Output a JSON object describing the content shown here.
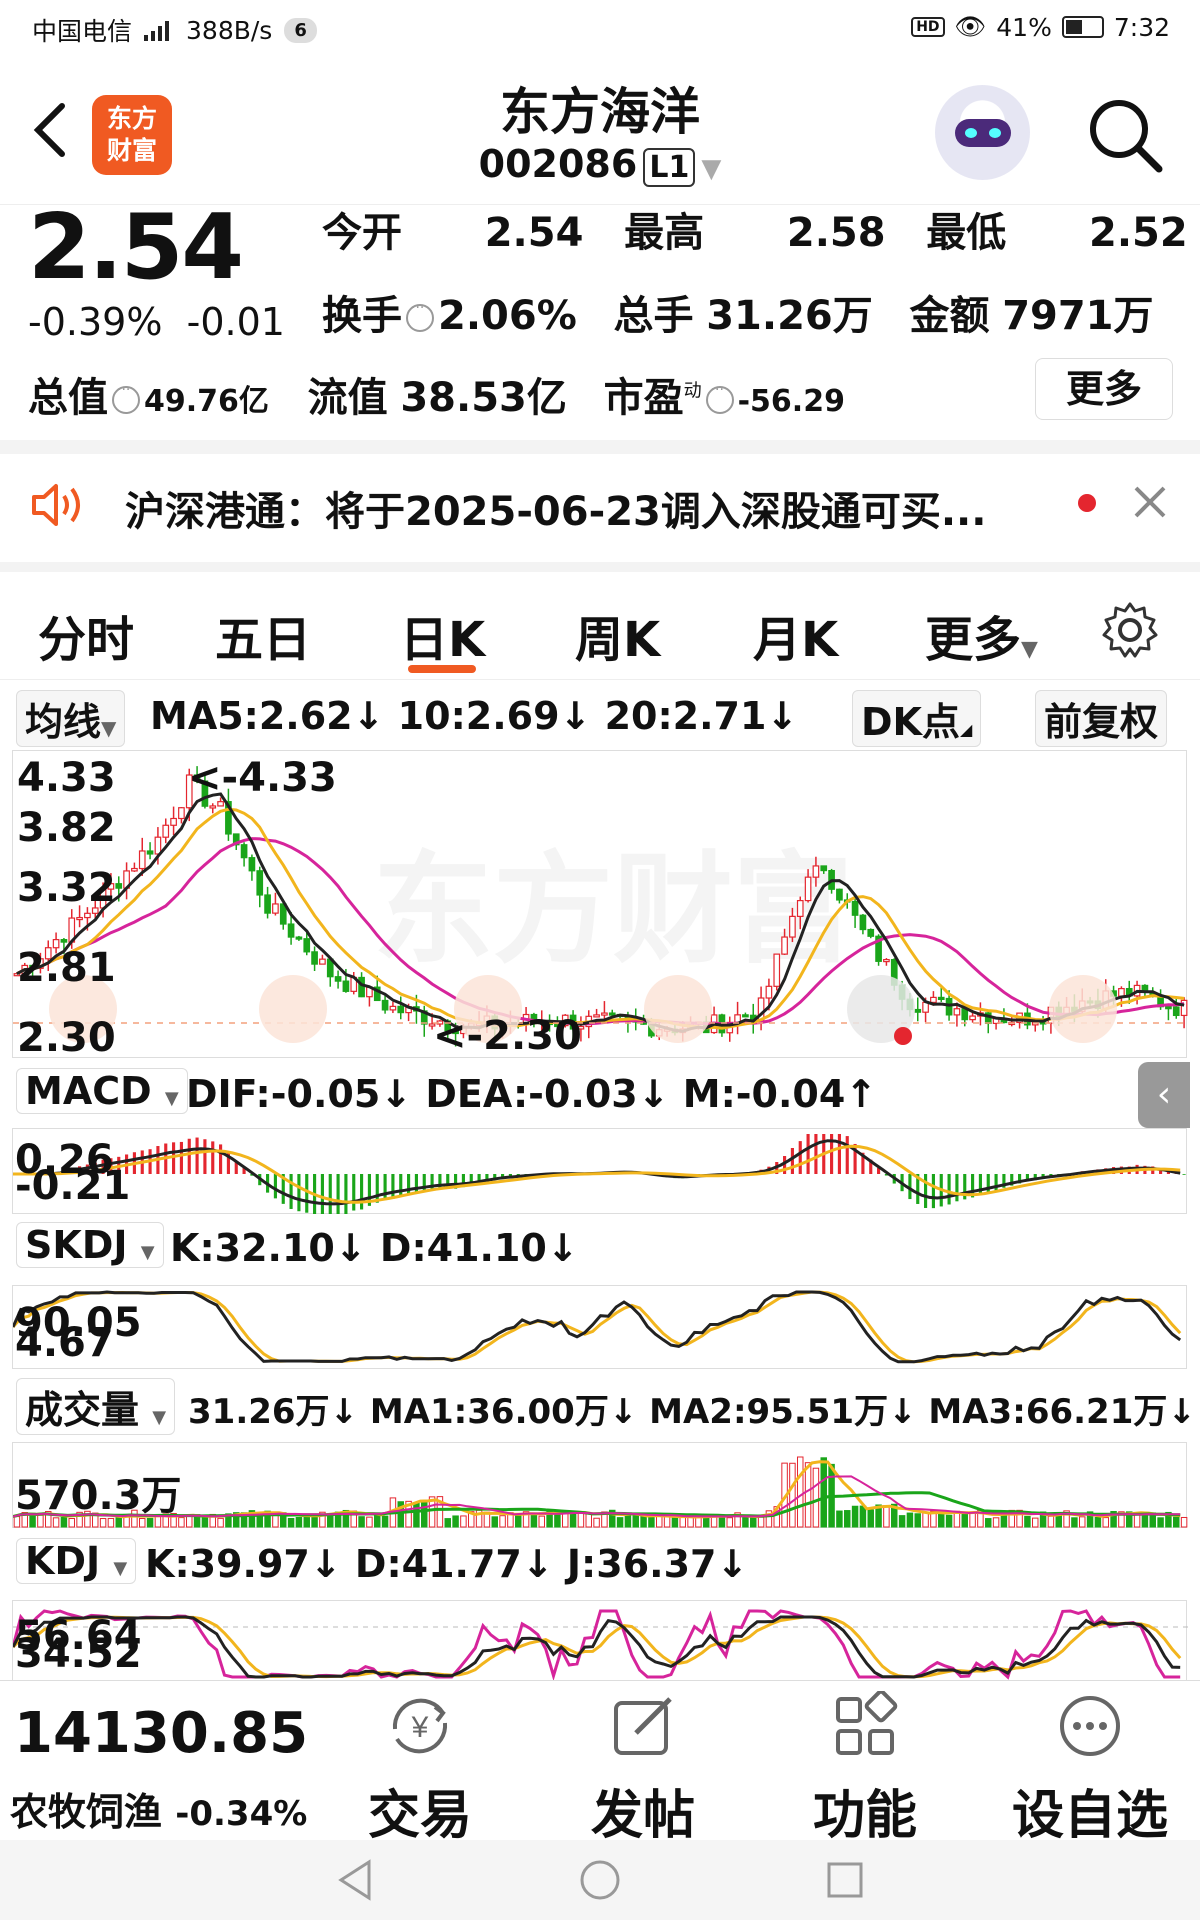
{
  "status_bar": {
    "carrier": "中国电信",
    "network": "4G",
    "speed": "388B/s",
    "notif_count": "6",
    "battery": "41%",
    "time": "7:32"
  },
  "header": {
    "logo_text_1": "东方",
    "logo_text_2": "财富",
    "stock_name": "东方海洋",
    "stock_code": "002086",
    "level": "L1"
  },
  "quote": {
    "price": "2.54",
    "change_pct": "-0.39%",
    "change_abs": "-0.01",
    "open_label": "今开",
    "open": "2.54",
    "high_label": "最高",
    "high": "2.58",
    "low_label": "最低",
    "low": "2.52",
    "turnover_label": "换手",
    "turnover": "2.06%",
    "volume_label": "总手",
    "volume": "31.26万",
    "amount_label": "金额",
    "amount": "7971万",
    "mcap_label": "总值",
    "mcap": "49.76亿",
    "float_label": "流值",
    "float_cap": "38.53亿",
    "pe_label": "市盈",
    "pe_sup": "动",
    "pe": "-56.29",
    "more": "更多"
  },
  "notice": {
    "text": "沪深港通：将于2025-06-23调入深股通可买..."
  },
  "tabs": [
    "分时",
    "五日",
    "日K",
    "周K",
    "月K",
    "更多"
  ],
  "active_tab": 2,
  "chart": {
    "ma_label": "均线",
    "ma_text": "MA5:2.62↓ 10:2.69↓ 20:2.71↓",
    "dk_label": "DK点",
    "adj_label": "前复权",
    "price_axis": [
      "4.33",
      "3.82",
      "3.32",
      "2.81",
      "2.30"
    ],
    "high_mark": "4.33",
    "low_mark": "2.30",
    "macd_label": "MACD",
    "macd_text": "DIF:-0.05↓  DEA:-0.03↓  M:-0.04↑",
    "macd_axis_top": "0.26",
    "macd_axis_bottom": "-0.21",
    "skdj_label": "SKDJ",
    "skdj_text": "K:32.10↓  D:41.10↓",
    "skdj_axis_top": "90.05",
    "skdj_axis_bottom": "4.67",
    "vol_label": "成交量",
    "vol_text": "31.26万↓ MA1:36.00万↓ MA2:95.51万↓ MA3:66.21万↓",
    "vol_axis": "570.3万",
    "kdj_label": "KDJ",
    "kdj_text": "K:39.97↓  D:41.77↓  J:36.37↓",
    "kdj_axis_top": "56.64",
    "kdj_axis_bottom": "34.52",
    "watermark": "东方财富",
    "up_color": "#e4262f",
    "down_color": "#1aa51a",
    "ma5_color": "#222222",
    "ma10_color": "#f2b51d",
    "ma20_color": "#d6249b"
  },
  "bottom": {
    "index_value": "14130.85",
    "index_name": "农牧饲渔",
    "index_change": "-0.34%",
    "trade": "交易",
    "post": "发帖",
    "func": "功能",
    "watch": "设自选"
  }
}
